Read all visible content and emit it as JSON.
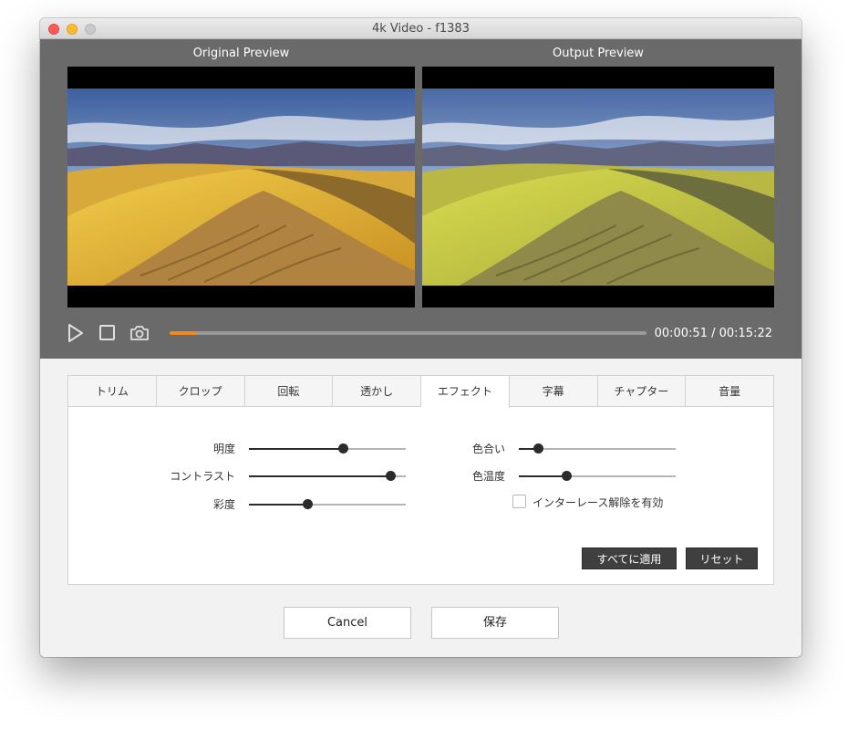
{
  "window": {
    "title": "4k Video - f1383"
  },
  "preview": {
    "original_label": "Original Preview",
    "output_label": "Output  Preview",
    "progress_fraction": 0.057,
    "timecode": "00:00:51 / 00:15:22",
    "progress_color": "#f08a1e"
  },
  "tabs": [
    {
      "label": "トリム"
    },
    {
      "label": "クロップ"
    },
    {
      "label": "回転"
    },
    {
      "label": "透かし"
    },
    {
      "label": "エフェクト",
      "active": true
    },
    {
      "label": "字幕"
    },
    {
      "label": "チャプター"
    },
    {
      "label": "音量"
    }
  ],
  "effects": {
    "brightness": {
      "label": "明度",
      "value": 0.6
    },
    "contrast": {
      "label": "コントラスト",
      "value": 0.9
    },
    "saturation": {
      "label": "彩度",
      "value": 0.37
    },
    "hue": {
      "label": "色合い",
      "value": 0.12
    },
    "temperature": {
      "label": "色温度",
      "value": 0.3
    },
    "deinterlace_label": "インターレース解除を有効",
    "deinterlace_checked": false,
    "apply_all_label": "すべてに適用",
    "reset_label": "リセット"
  },
  "footer": {
    "cancel_label": "Cancel",
    "save_label": "保存"
  }
}
